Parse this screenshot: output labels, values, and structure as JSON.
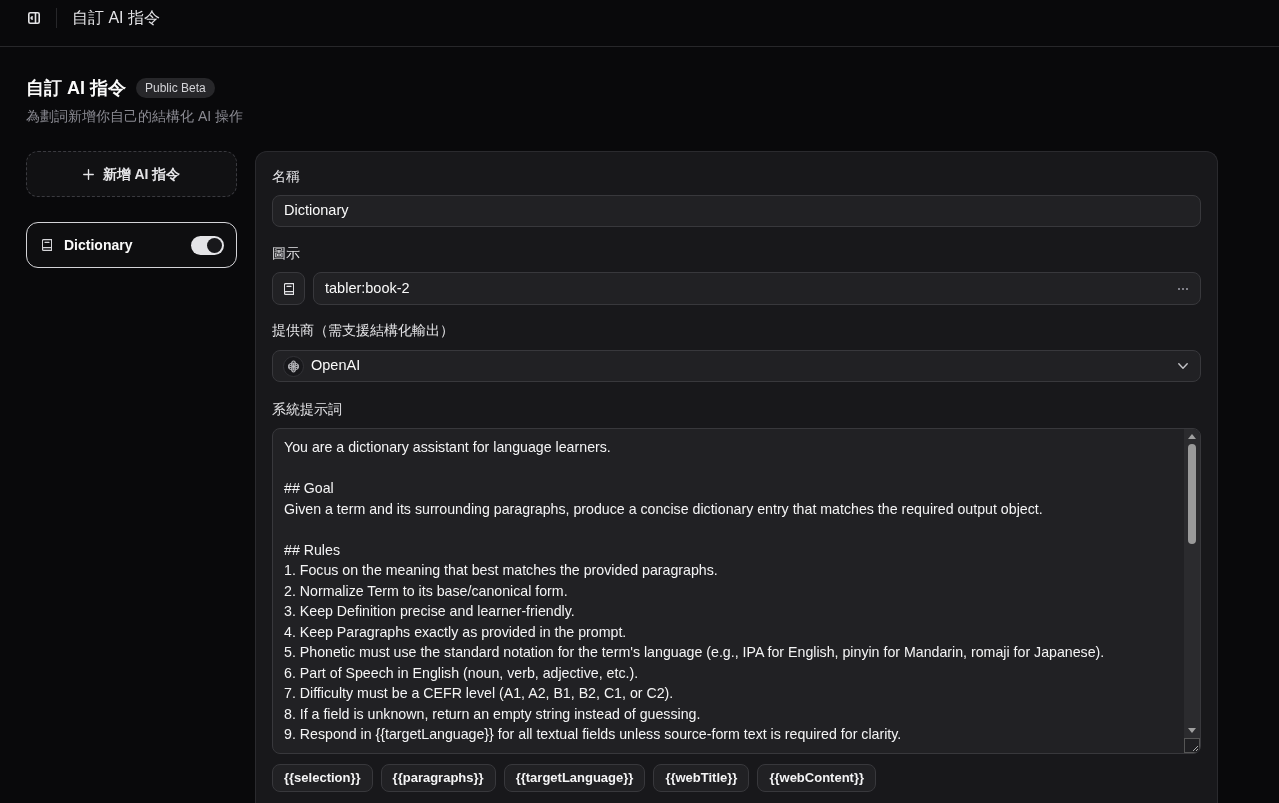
{
  "header": {
    "title": "自訂 AI 指令"
  },
  "page": {
    "title": "自訂 AI 指令",
    "badge": "Public Beta",
    "subtitle": "為劃詞新增你自己的結構化 AI 操作"
  },
  "sidebar": {
    "add_button": "新增 AI 指令",
    "items": [
      {
        "label": "Dictionary",
        "selected": true,
        "on": true
      }
    ]
  },
  "form": {
    "name": {
      "label": "名稱",
      "value": "Dictionary"
    },
    "icon": {
      "label": "圖示",
      "value": "tabler:book-2"
    },
    "provider": {
      "label": "提供商（需支援結構化輸出）",
      "value": "OpenAI"
    },
    "system_prompt": {
      "label": "系統提示詞",
      "value": "You are a dictionary assistant for language learners.\n\n## Goal\nGiven a term and its surrounding paragraphs, produce a concise dictionary entry that matches the required output object.\n\n## Rules\n1. Focus on the meaning that best matches the provided paragraphs.\n2. Normalize Term to its base/canonical form.\n3. Keep Definition precise and learner-friendly.\n4. Keep Paragraphs exactly as provided in the prompt.\n5. Phonetic must use the standard notation for the term's language (e.g., IPA for English, pinyin for Mandarin, romaji for Japanese).\n6. Part of Speech in English (noun, verb, adjective, etc.).\n7. Difficulty must be a CEFR level (A1, A2, B1, B2, C1, or C2).\n8. If a field is unknown, return an empty string instead of guessing.\n9. Respond in {{targetLanguage}} for all textual fields unless source-form text is required for clarity."
    },
    "variables": [
      "{{selection}}",
      "{{paragraphs}}",
      "{{targetLanguage}}",
      "{{webTitle}}",
      "{{webContent}}"
    ]
  }
}
